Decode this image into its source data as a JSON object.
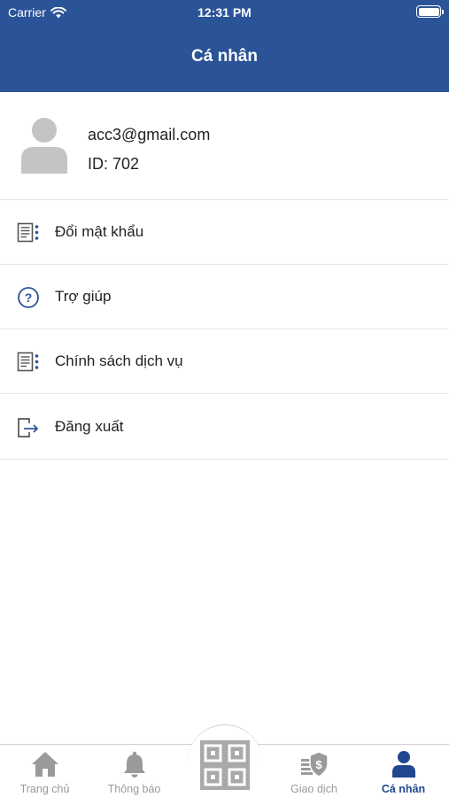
{
  "status_bar": {
    "carrier": "Carrier",
    "time": "12:31 PM"
  },
  "header": {
    "title": "Cá nhân"
  },
  "profile": {
    "email": "acc3@gmail.com",
    "id": "ID: 702"
  },
  "menu": [
    {
      "label": "Đổi mật khẩu",
      "icon": "document-list-icon"
    },
    {
      "label": "Trợ giúp",
      "icon": "help-icon"
    },
    {
      "label": "Chính sách dịch vụ",
      "icon": "document-list-icon"
    },
    {
      "label": "Đăng xuất",
      "icon": "logout-icon"
    }
  ],
  "tabbar": {
    "tabs": [
      {
        "label": "Trang chủ",
        "icon": "home-icon",
        "active": false
      },
      {
        "label": "Thông báo",
        "icon": "bell-icon",
        "active": false
      },
      {
        "label": "",
        "icon": "qr-code-icon",
        "active": false
      },
      {
        "label": "Giao dịch",
        "icon": "money-shield-icon",
        "active": false
      },
      {
        "label": "Cá nhân",
        "icon": "person-icon",
        "active": true
      }
    ]
  },
  "colors": {
    "primary": "#2a5398",
    "active_tab": "#21488f",
    "inactive_tab": "#9a9a9a",
    "divider": "#e6e6e6"
  }
}
